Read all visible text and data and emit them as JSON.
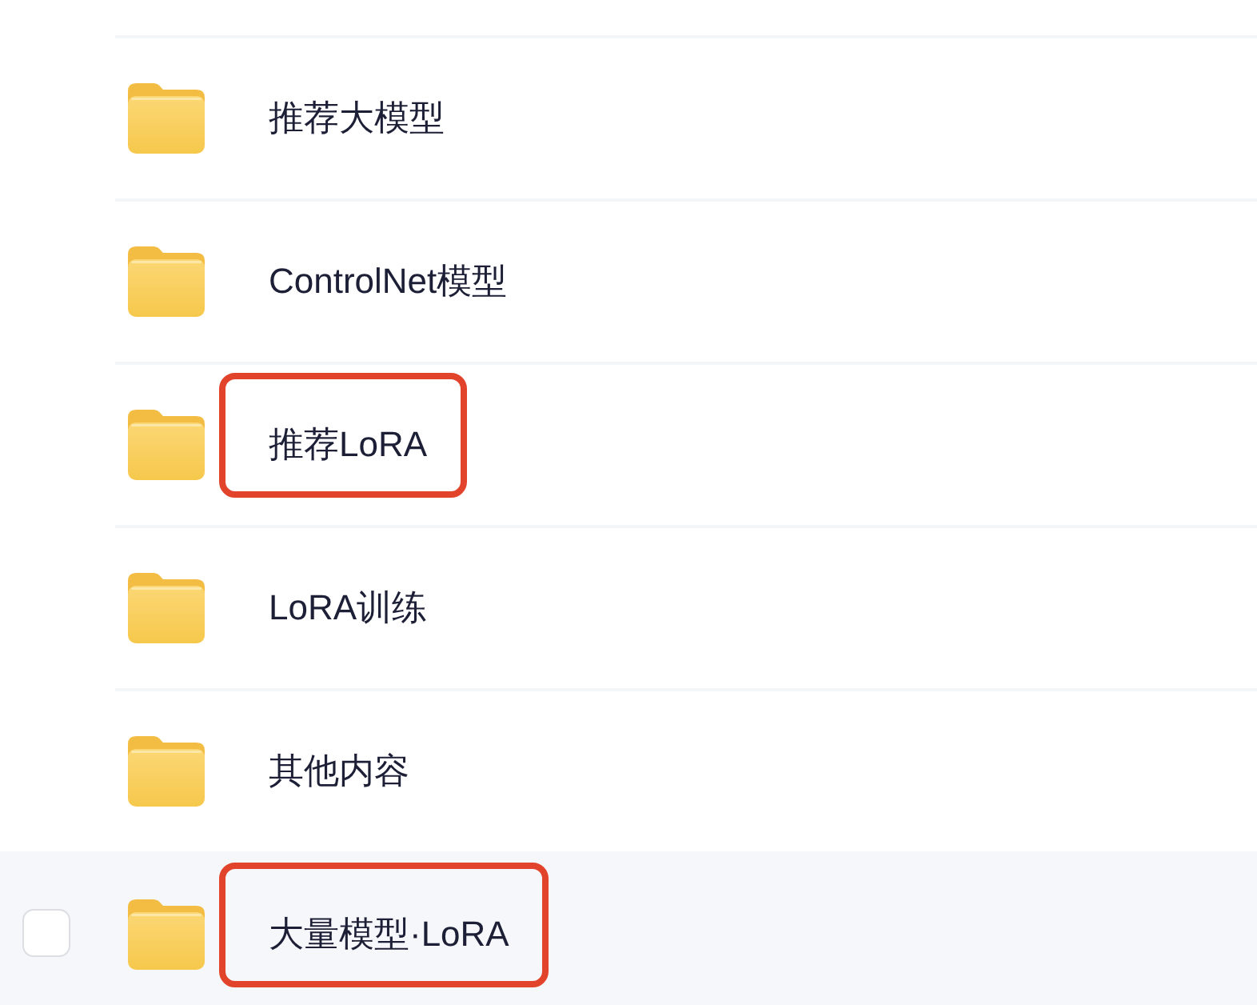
{
  "items": [
    {
      "name": "推荐大模型",
      "annotated": false,
      "hovered": false,
      "checked": false
    },
    {
      "name": "ControlNet模型",
      "annotated": false,
      "hovered": false,
      "checked": false
    },
    {
      "name": "推荐LoRA",
      "annotated": true,
      "hovered": false,
      "checked": false
    },
    {
      "name": "LoRA训练",
      "annotated": false,
      "hovered": false,
      "checked": false
    },
    {
      "name": "其他内容",
      "annotated": false,
      "hovered": false,
      "checked": false
    },
    {
      "name": "大量模型·LoRA",
      "annotated": true,
      "hovered": true,
      "checked": false
    }
  ]
}
